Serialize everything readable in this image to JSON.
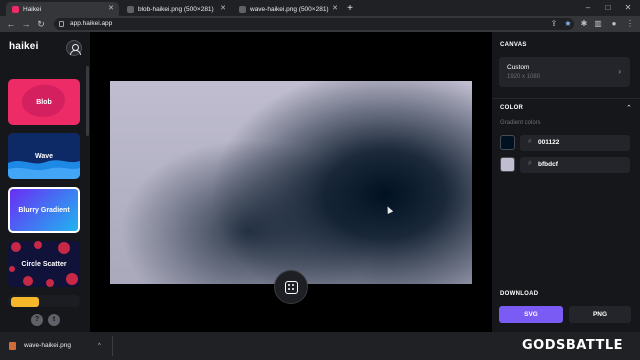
{
  "browser": {
    "tabs": [
      {
        "title": "Haikei",
        "active": true
      },
      {
        "title": "blob-haikei.png (500×281)",
        "active": false
      },
      {
        "title": "wave-haikei.png (500×281)",
        "active": false
      }
    ],
    "new_tab": "+",
    "url": "app.haikei.app",
    "nav": {
      "back": "←",
      "forward": "→",
      "reload": "↻"
    },
    "window": {
      "minimize": "–",
      "maximize": "□",
      "close": "✕"
    }
  },
  "sidebar": {
    "logo": "haikei",
    "generators": [
      {
        "label": "Blob",
        "color": "#ec2b67"
      },
      {
        "label": "Wave",
        "color": "#0d2a66"
      },
      {
        "label": "Blurry Gradient",
        "selected": true
      },
      {
        "label": "Circle Scatter",
        "color": "#10123a"
      }
    ],
    "help": "?",
    "twitter": "t"
  },
  "canvas_preview": {
    "colors": [
      "#001122",
      "#bfbdcf"
    ]
  },
  "panel": {
    "canvas_title": "CANVAS",
    "canvas_size_label": "Custom",
    "canvas_size_value": "1920 x 1080",
    "color_title": "COLOR",
    "gradient_label": "Gradient colors",
    "colors": [
      {
        "hash": "#",
        "hex": "001122",
        "swatch": "#001122"
      },
      {
        "hash": "#",
        "hex": "bfbdcf",
        "swatch": "#bfbdcf"
      }
    ],
    "download_title": "DOWNLOAD",
    "svg_button": "SVG",
    "png_button": "PNG",
    "accent": "#7a5cf5"
  },
  "downloads_bar": {
    "file": "wave-haikei.png",
    "chevron": "^"
  },
  "watermark": "GODSBATTLE"
}
